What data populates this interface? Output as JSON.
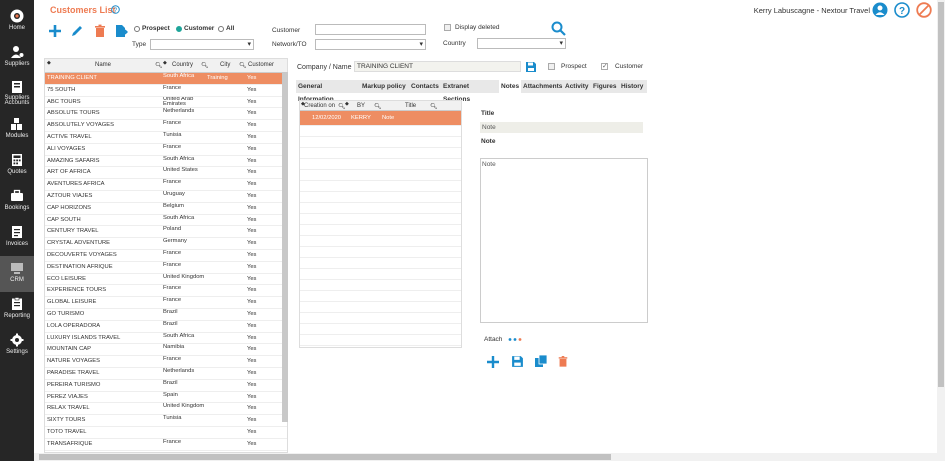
{
  "sidebar": {
    "items": [
      {
        "label": "Home",
        "icon": "home-icon"
      },
      {
        "label": "Suppliers",
        "icon": "suppliers-icon"
      },
      {
        "label": "Suppliers Accounts",
        "icon": "suppliers-accounts-icon"
      },
      {
        "label": "Modules",
        "icon": "modules-icon"
      },
      {
        "label": "Quotes",
        "icon": "calculator-icon"
      },
      {
        "label": "Bookings",
        "icon": "bookings-icon"
      },
      {
        "label": "Invoices",
        "icon": "invoices-icon"
      },
      {
        "label": "CRM",
        "icon": "crm-icon"
      },
      {
        "label": "Reporting",
        "icon": "reporting-icon"
      },
      {
        "label": "Settings",
        "icon": "settings-icon"
      }
    ]
  },
  "header": {
    "title": "Customers List",
    "user": "Kerry Labuscagne - Nextour Travel"
  },
  "filters": {
    "prospect": "Prospect",
    "customer": "Customer",
    "all": "All",
    "type_label": "Type",
    "customer_label": "Customer",
    "network_label": "Network/TO",
    "display_deleted": "Display deleted",
    "country_label": "Country"
  },
  "grid": {
    "columns": [
      "Name",
      "Country",
      "City",
      "Customer"
    ],
    "rows": [
      [
        "TRAINING CLIENT",
        "South Africa",
        "Training",
        "Yes"
      ],
      [
        "75 SOUTH",
        "France",
        "",
        "Yes"
      ],
      [
        "ABC TOURS",
        "United Arab Emirates",
        "",
        "Yes"
      ],
      [
        "ABSOLUTE TOURS",
        "Netherlands",
        "",
        "Yes"
      ],
      [
        "ABSOLUTELY VOYAGES",
        "France",
        "",
        "Yes"
      ],
      [
        "ACTIVE TRAVEL",
        "Tunisia",
        "",
        "Yes"
      ],
      [
        "ALI VOYAGES",
        "France",
        "",
        "Yes"
      ],
      [
        "AMAZING SAFARIS",
        "South Africa",
        "",
        "Yes"
      ],
      [
        "ART OF AFRICA",
        "United States",
        "",
        "Yes"
      ],
      [
        "AVENTURES AFRICA",
        "France",
        "",
        "Yes"
      ],
      [
        "AZTOUR VIAJES",
        "Uruguay",
        "",
        "Yes"
      ],
      [
        "CAP HORIZONS",
        "Belgium",
        "",
        "Yes"
      ],
      [
        "CAP SOUTH",
        "South Africa",
        "",
        "Yes"
      ],
      [
        "CENTURY TRAVEL",
        "Poland",
        "",
        "Yes"
      ],
      [
        "CRYSTAL ADVENTURE",
        "Germany",
        "",
        "Yes"
      ],
      [
        "DECOUVERTE VOYAGES",
        "France",
        "",
        "Yes"
      ],
      [
        "DESTINATION AFRIQUE",
        "France",
        "",
        "Yes"
      ],
      [
        "ECO LEISURE",
        "United Kingdom",
        "",
        "Yes"
      ],
      [
        "EXPERIENCE TOURS",
        "France",
        "",
        "Yes"
      ],
      [
        "GLOBAL LEISURE",
        "France",
        "",
        "Yes"
      ],
      [
        "GO TURISMO",
        "Brazil",
        "",
        "Yes"
      ],
      [
        "LOLA OPERADORA",
        "Brazil",
        "",
        "Yes"
      ],
      [
        "LUXURY ISLANDS TRAVEL",
        "South Africa",
        "",
        "Yes"
      ],
      [
        "MOUNTAIN CAP",
        "Namibia",
        "",
        "Yes"
      ],
      [
        "NATURE VOYAGES",
        "France",
        "",
        "Yes"
      ],
      [
        "PARADISE TRAVEL",
        "Netherlands",
        "",
        "Yes"
      ],
      [
        "PEREIRA TURISMO",
        "Brazil",
        "",
        "Yes"
      ],
      [
        "PEREZ VIAJES",
        "Spain",
        "",
        "Yes"
      ],
      [
        "RELAX TRAVEL",
        "United Kingdom",
        "",
        "Yes"
      ],
      [
        "SIXTY TOURS",
        "Tunisia",
        "",
        "Yes"
      ],
      [
        "TOTO TRAVEL",
        "",
        "",
        "Yes"
      ],
      [
        "TRANSAFRIQUE",
        "France",
        "",
        "Yes"
      ]
    ]
  },
  "detail": {
    "company_label": "Company / Name",
    "company_value": "TRAINING CLIENT",
    "prospect": "Prospect",
    "customer": "Customer",
    "tabs": [
      "General Information",
      "Markup policy",
      "Contacts",
      "Extranet Sections",
      "Notes",
      "Attachments",
      "Activity",
      "Figures",
      "History"
    ],
    "notes_columns": [
      "Creation on",
      "BY",
      "Title"
    ],
    "note_row": [
      "12/02/2020",
      "KERRY",
      "Note"
    ],
    "title_label": "Title",
    "title_value": "Note",
    "note_label": "Note",
    "note_value": "Note",
    "attach_label": "Attach"
  },
  "colors": {
    "accent": "#ee7b52",
    "teal": "#1fa59a",
    "blue": "#1a8ccc"
  }
}
